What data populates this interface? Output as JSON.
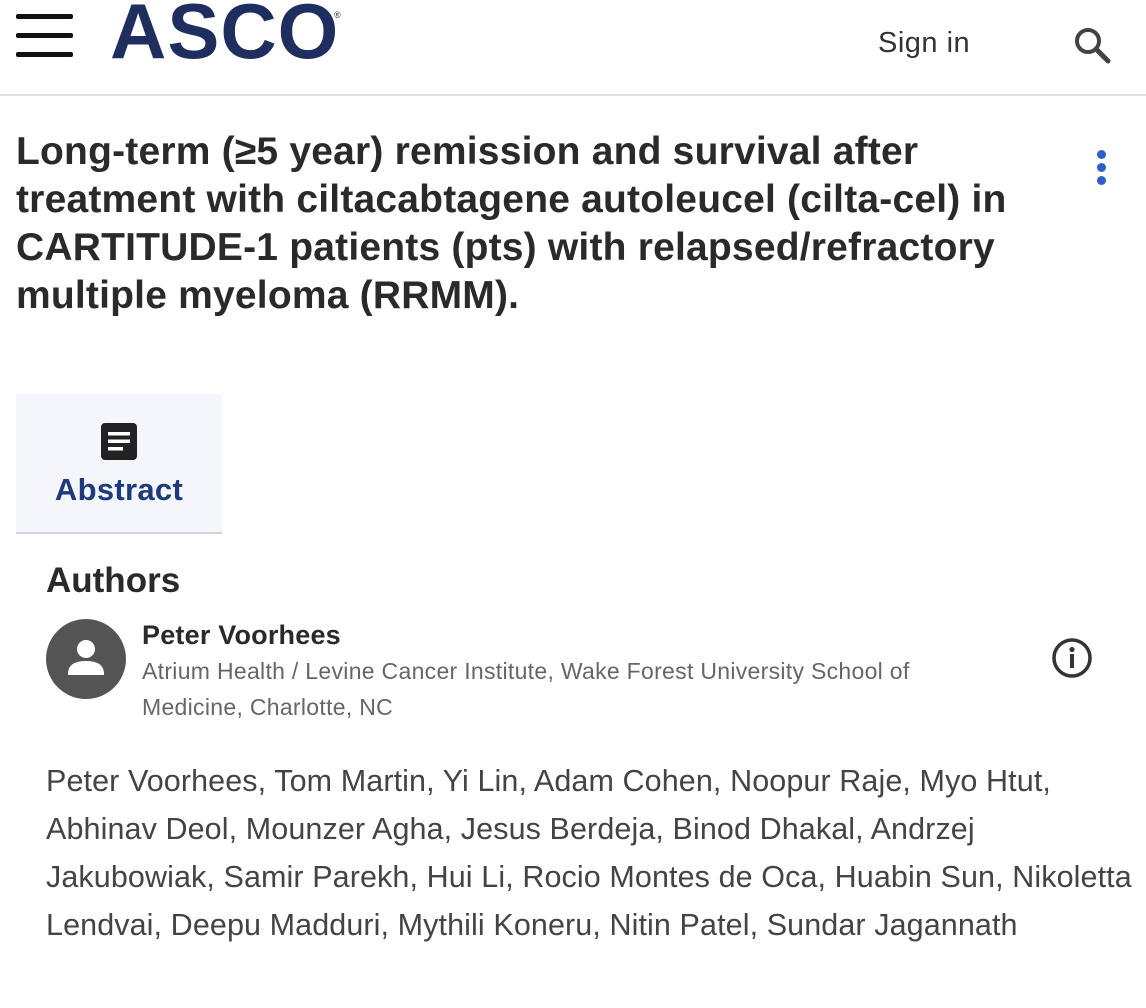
{
  "header": {
    "logo_text": "ASCO",
    "logo_mark": "®",
    "sign_in_label": "Sign in",
    "icons": {
      "menu": "hamburger-menu-icon",
      "search": "search-icon"
    }
  },
  "article": {
    "title": "Long-term (≥5 year) remission and survival after treatment with ciltacabtagene autoleucel (cilta-cel) in CARTITUDE-1 patients (pts) with relapsed/refractory multiple myeloma (RRMM).",
    "more_icon": "kebab-menu-icon"
  },
  "tabs": [
    {
      "label": "Abstract",
      "icon": "document-icon",
      "selected": true
    }
  ],
  "authors": {
    "heading": "Authors",
    "primary": {
      "name": "Peter Voorhees",
      "affiliation": "Atrium Health / Levine Cancer Institute, Wake Forest University School of Medicine, Charlotte, NC",
      "avatar_icon": "person-icon",
      "info_icon": "info-icon"
    },
    "list": "Peter Voorhees, Tom Martin, Yi Lin, Adam Cohen, Noopur Raje, Myo Htut, Abhinav Deol, Mounzer Agha, Jesus Berdeja, Binod Dhakal, Andrzej Jakubowiak, Samir Parekh, Hui Li, Rocio Montes de Oca, Huabin Sun, Nikoletta Lendvai, Deepu Madduri, Mythili Koneru, Nitin Patel, Sundar Jagannath"
  },
  "colors": {
    "brand_navy": "#1e2f5f",
    "tab_label": "#1f3a7a",
    "kebab_blue": "#2d5fc6",
    "tab_background": "#f4f6fb"
  }
}
